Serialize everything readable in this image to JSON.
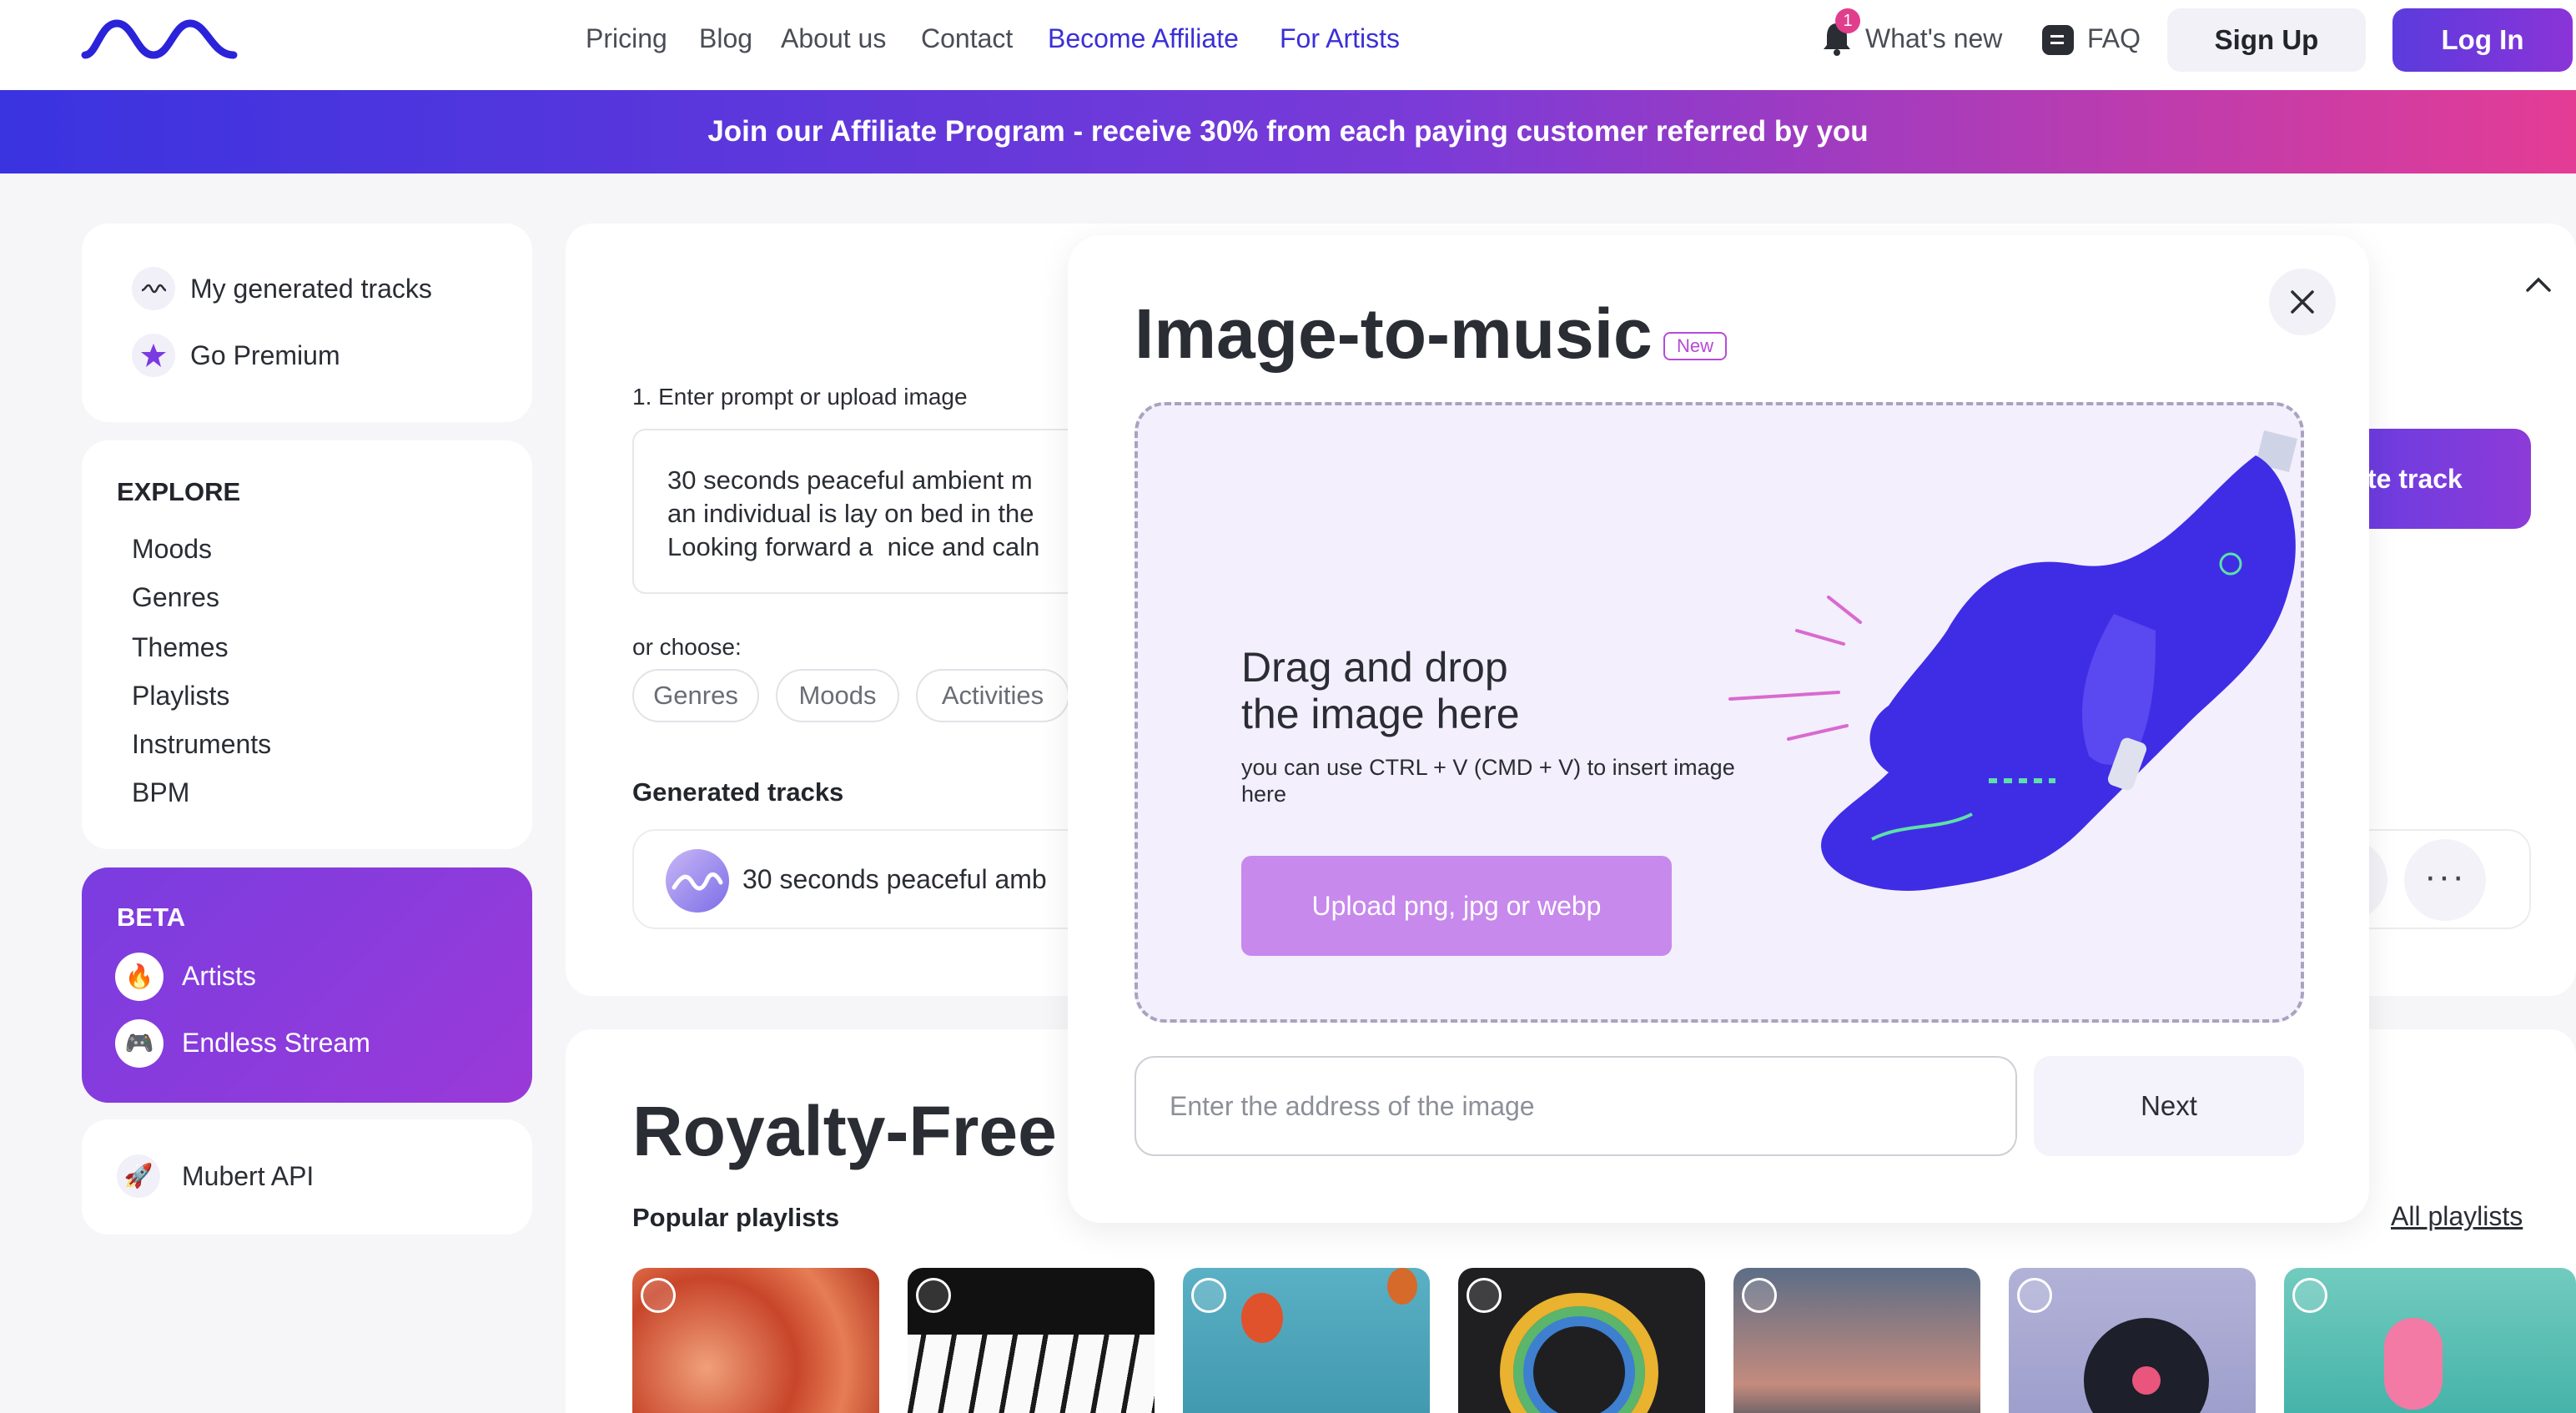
{
  "header": {
    "nav": [
      {
        "label": "Pricing"
      },
      {
        "label": "Blog"
      },
      {
        "label": "About us"
      },
      {
        "label": "Contact"
      },
      {
        "label": "Become Affiliate"
      },
      {
        "label": "For Artists"
      }
    ],
    "whats_new": "What's new",
    "notification_count": "1",
    "faq": "FAQ",
    "signup": "Sign Up",
    "login": "Log In"
  },
  "banner": {
    "text": "Join our Affiliate Program - receive 30% from each paying customer referred by you"
  },
  "sidebar": {
    "top": [
      {
        "label": "My generated tracks",
        "icon": "wave-icon"
      },
      {
        "label": "Go Premium",
        "icon": "star-icon"
      }
    ],
    "explore": {
      "title": "EXPLORE",
      "items": [
        "Moods",
        "Genres",
        "Themes",
        "Playlists",
        "Instruments",
        "BPM"
      ]
    },
    "beta": {
      "title": "BETA",
      "items": [
        {
          "label": "Artists",
          "icon": "fire-icon"
        },
        {
          "label": "Endless Stream",
          "icon": "gamepad-icon"
        }
      ]
    },
    "api": {
      "label": "Mubert API",
      "icon": "rocket-icon"
    }
  },
  "main": {
    "step1_label": "1. Enter prompt or upload image",
    "prompt_text": "30 seconds peaceful ambient m\nan individual is lay on bed in the\nLooking forward a  nice and caln",
    "or_choose": "or choose:",
    "chips": [
      "Genres",
      "Moods",
      "Activities"
    ],
    "generate_label": "te track",
    "generated_title": "Generated tracks",
    "track_name": "30 seconds peaceful amb",
    "royalty_title": "Royalty-Free",
    "popular_title": "Popular playlists",
    "all_playlists": "All playlists"
  },
  "modal": {
    "title": "Image-to-music",
    "badge": "New",
    "drop_title_line1": "Drag and drop",
    "drop_title_line2": "the image here",
    "drop_hint": "you can use CTRL + V (CMD + V) to insert image here",
    "upload_button": "Upload png, jpg or webp",
    "url_placeholder": "Enter the address of the image",
    "next_button": "Next"
  },
  "colors": {
    "accent": "#6a3ce0",
    "banner_start": "#3a33e0",
    "banner_end": "#e43c95",
    "upload_button": "#c789ec"
  }
}
